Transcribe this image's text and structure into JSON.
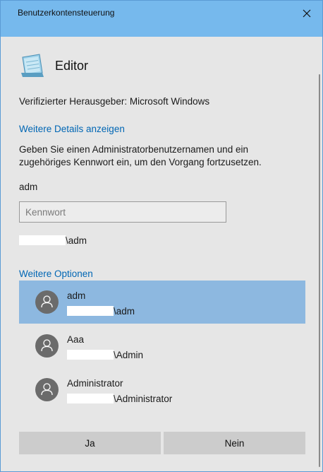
{
  "window": {
    "title": "Benutzerkontensteuerung",
    "accent_color": "#76b9ed"
  },
  "app": {
    "icon": "notepad-icon",
    "name": "Editor"
  },
  "publisher": "Verifizierter Herausgeber: Microsoft Windows",
  "details_link": "Weitere Details anzeigen",
  "instruction": "Geben Sie einen Administratorbenutzernamen und ein zugehöriges Kennwort ein, um den Vorgang fortzusetzen.",
  "credentials": {
    "username": "adm",
    "password_placeholder": "Kennwort",
    "domain_suffix": "\\adm"
  },
  "more_options_link": "Weitere Optionen",
  "accounts": [
    {
      "name": "adm",
      "domain_suffix": "\\adm",
      "selected": true
    },
    {
      "name": "Aaa",
      "domain_suffix": "\\Admin",
      "selected": false
    },
    {
      "name": "Administrator",
      "domain_suffix": "\\Administrator",
      "selected": false
    }
  ],
  "buttons": {
    "yes": "Ja",
    "no": "Nein"
  }
}
